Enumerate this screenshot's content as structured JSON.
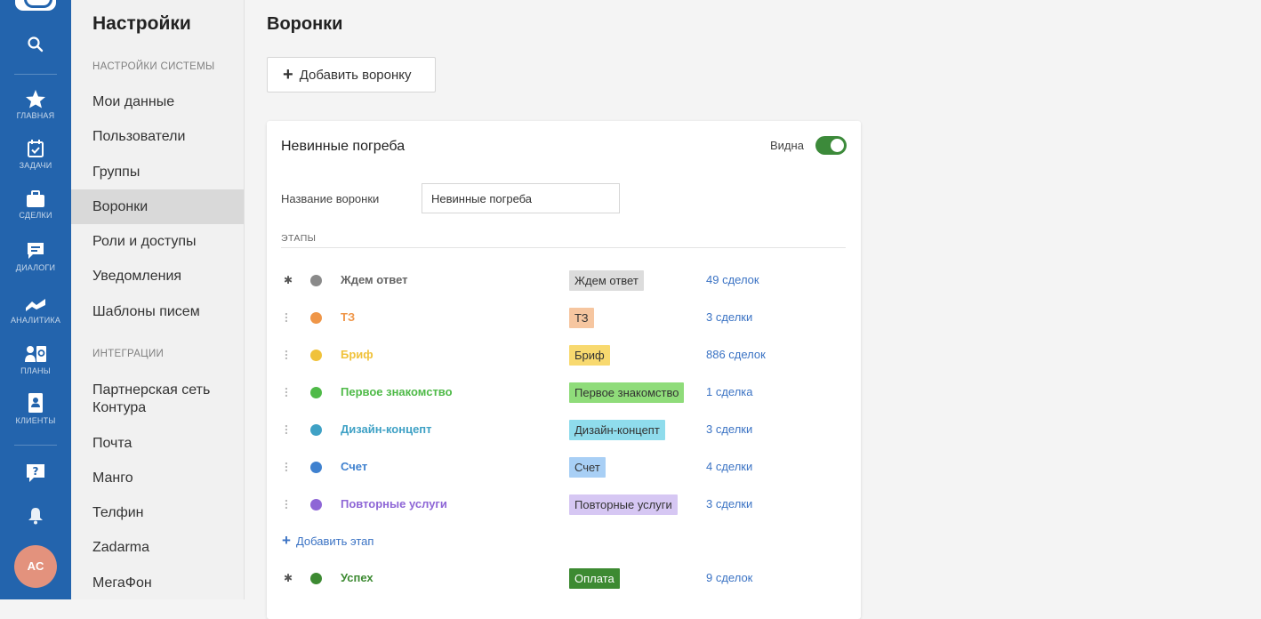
{
  "rail": {
    "items": [
      {
        "label": "ГЛАВНАЯ",
        "icon": "star-icon"
      },
      {
        "label": "ЗАДАЧИ",
        "icon": "calendar-check-icon"
      },
      {
        "label": "СДЕЛКИ",
        "icon": "briefcase-icon"
      },
      {
        "label": "ДИАЛОГИ",
        "icon": "chat-icon"
      },
      {
        "label": "АНАЛИТИКА",
        "icon": "analytics-icon"
      },
      {
        "label": "ПЛАНЫ",
        "icon": "plans-icon"
      },
      {
        "label": "КЛИЕНТЫ",
        "icon": "contacts-icon"
      }
    ],
    "avatar": "AC"
  },
  "settings": {
    "title": "Настройки",
    "section_system": "НАСТРОЙКИ СИСТЕМЫ",
    "system_items": [
      "Мои данные",
      "Пользователи",
      "Группы",
      "Воронки",
      "Роли и доступы",
      "Уведомления",
      "Шаблоны писем"
    ],
    "active_item": "Воронки",
    "section_integrations": "ИНТЕГРАЦИИ",
    "integration_items": [
      "Партнерская сеть\nКонтура",
      "Почта",
      "Манго",
      "Телфин",
      "Zadarma",
      "МегаФон"
    ]
  },
  "main": {
    "title": "Воронки",
    "add_funnel_label": "Добавить воронку"
  },
  "funnel": {
    "title": "Невинные погреба",
    "visible_label": "Видна",
    "visible": true,
    "name_label": "Название воронки",
    "name_value": "Невинные погреба",
    "stages_header": "ЭТАПЫ",
    "add_stage_label": "Добавить этап",
    "stages": [
      {
        "name": "Ждем ответ",
        "tag": "Ждем ответ",
        "count": "49 сделок",
        "color": "#8a8a8a",
        "tag_bg": "#dcdcdc",
        "tag_fg": "#333333",
        "handle": "pin"
      },
      {
        "name": "ТЗ",
        "tag": "ТЗ",
        "count": "3 сделки",
        "color": "#ef9648",
        "tag_bg": "#f6c6a0",
        "tag_fg": "#333333",
        "handle": "drag"
      },
      {
        "name": "Бриф",
        "tag": "Бриф",
        "count": "886 сделок",
        "color": "#f0c23b",
        "tag_bg": "#f8d96f",
        "tag_fg": "#333333",
        "handle": "drag"
      },
      {
        "name": "Первое знакомство",
        "tag": "Первое знакомство",
        "count": "1 сделка",
        "color": "#4fba48",
        "tag_bg": "#8fdc7a",
        "tag_fg": "#333333",
        "handle": "drag"
      },
      {
        "name": "Дизайн-концепт",
        "tag": "Дизайн-концепт",
        "count": "3 сделки",
        "color": "#3fa1c5",
        "tag_bg": "#8fdcec",
        "tag_fg": "#333333",
        "handle": "drag"
      },
      {
        "name": "Счет",
        "tag": "Счет",
        "count": "4 сделки",
        "color": "#3f81cf",
        "tag_bg": "#a8cff5",
        "tag_fg": "#333333",
        "handle": "drag"
      },
      {
        "name": "Повторные услуги",
        "tag": "Повторные услуги",
        "count": "3 сделки",
        "color": "#8e66d6",
        "tag_bg": "#d6c7f3",
        "tag_fg": "#333333",
        "handle": "drag"
      }
    ],
    "final_stage": {
      "name": "Успех",
      "tag": "Оплата",
      "count": "9 сделок",
      "color": "#3d8a32",
      "tag_bg": "#3d8a32",
      "tag_fg": "#ffffff",
      "handle": "pin"
    }
  }
}
